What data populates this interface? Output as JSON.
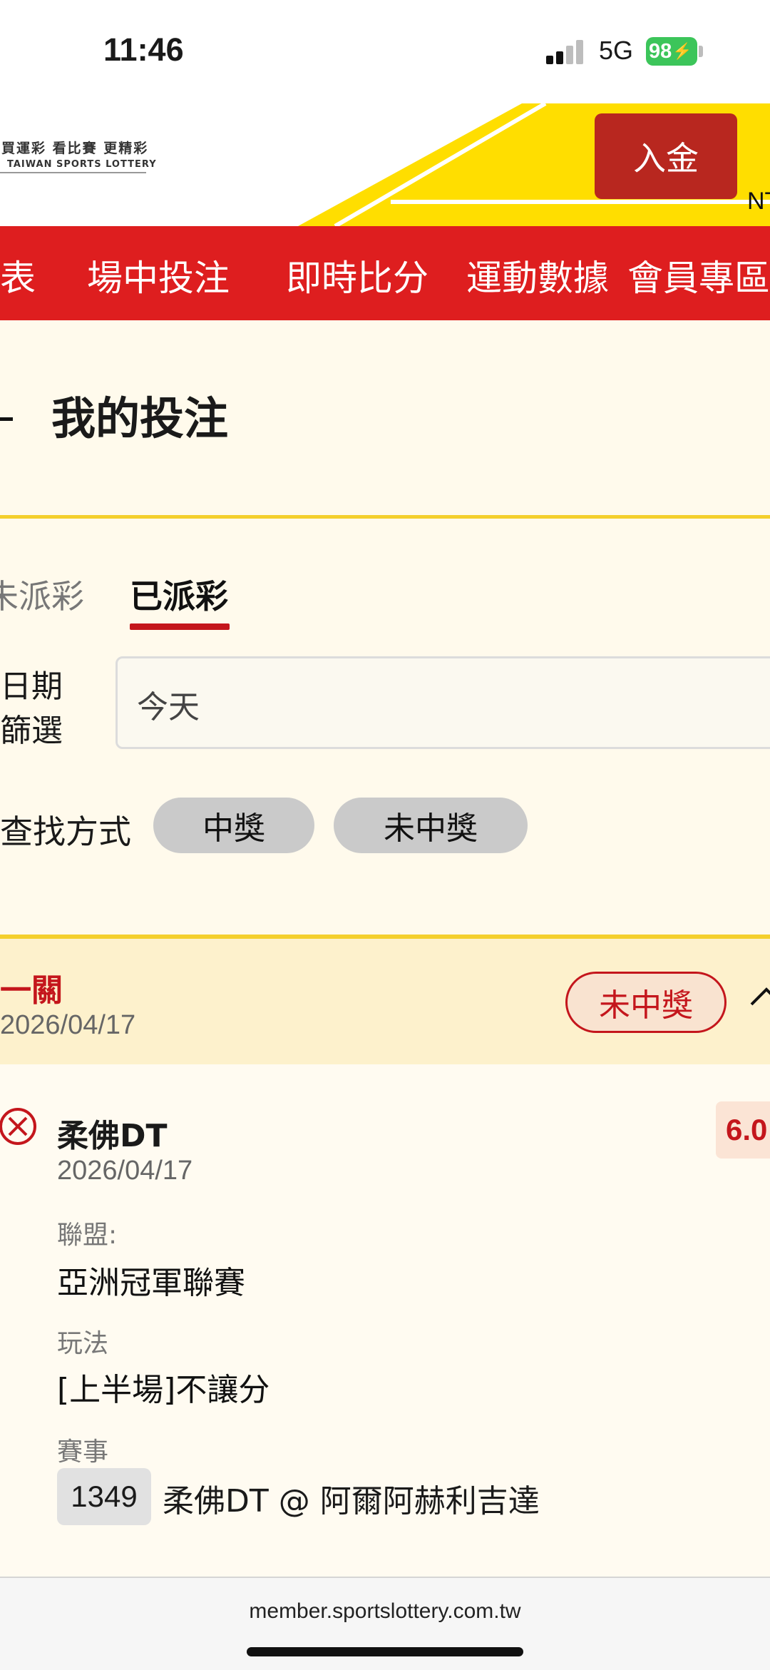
{
  "status_bar": {
    "time": "11:46",
    "network": "5G",
    "battery": "98"
  },
  "header": {
    "logo_line1": "買運彩 看比賽 更精彩",
    "logo_line2": "TAIWAN SPORTS LOTTERY",
    "deposit_label": "入金",
    "currency_partial": "NT"
  },
  "nav": {
    "items": [
      "表",
      "場中投注",
      "即時比分",
      "運動數據",
      "會員專區"
    ]
  },
  "page": {
    "title": "我的投注"
  },
  "tabs": {
    "unsettled": "未派彩",
    "settled": "已派彩"
  },
  "filter": {
    "date_label_line1": "日期",
    "date_label_line2": "篩選",
    "date_value": "今天",
    "search_label": "查找方式",
    "chip_win": "中獎",
    "chip_lose": "未中獎"
  },
  "bet": {
    "type": "一關",
    "date": "2026/04/17",
    "result": "未中獎",
    "selection": {
      "name": "柔佛DT",
      "date": "2026/04/17",
      "odds": "6.0",
      "league_label": "聯盟:",
      "league": "亞洲冠軍聯賽",
      "play_label": "玩法",
      "play": "[上半場]不讓分",
      "event_label": "賽事",
      "event_no": "1349",
      "event": "柔佛DT @ 阿爾阿赫利吉達"
    }
  },
  "browser": {
    "url": "member.sportslottery.com.tw"
  },
  "colors": {
    "brand_red": "#de1e1f",
    "accent_yellow": "#ffde00",
    "badge_red": "#c4161c"
  }
}
